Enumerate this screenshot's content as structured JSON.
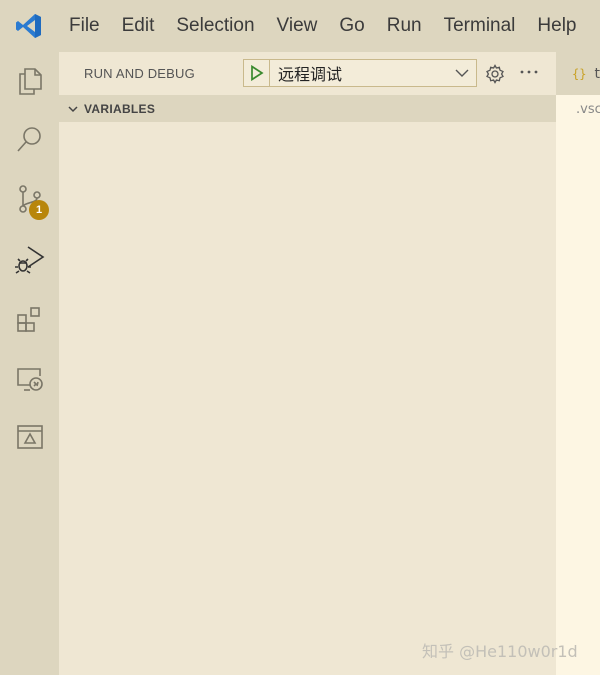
{
  "menu": [
    "File",
    "Edit",
    "Selection",
    "View",
    "Go",
    "Run",
    "Terminal",
    "Help"
  ],
  "activity": {
    "scm_badge": "1"
  },
  "sidebar": {
    "title": "RUN AND DEBUG",
    "config_selected": "远程调试",
    "section_title": "VARIABLES"
  },
  "editor": {
    "tab_icon": "{}",
    "tab_label": "t",
    "breadcrumb": ".vsc"
  },
  "watermark": "知乎 @He110w0r1d",
  "colors": {
    "vscode_blue": "#2b7bd1",
    "start_green": "#3a8a2e",
    "badge": "#b8860b",
    "chrome": "#ddd6bf",
    "sidebar_bg": "#efe7d3",
    "editor_bg": "#fdf6e3"
  }
}
